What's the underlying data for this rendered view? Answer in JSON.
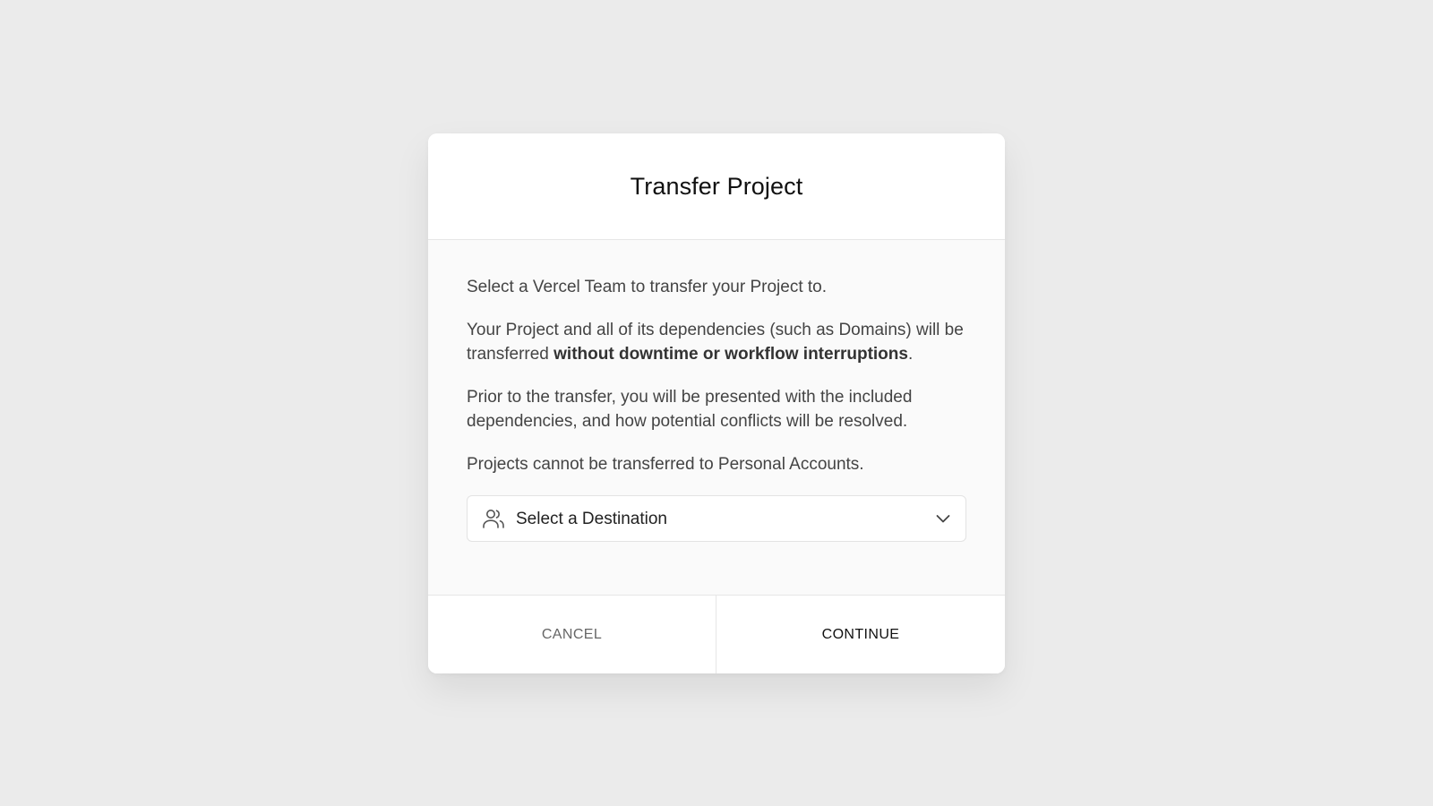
{
  "modal": {
    "title": "Transfer Project",
    "paragraphs": {
      "p1": "Select a Vercel Team to transfer your Project to.",
      "p2_start": "Your Project and all of its dependencies (such as Domains) will be transferred ",
      "p2_bold": "without downtime or workflow interruptions",
      "p2_end": ".",
      "p3": "Prior to the transfer, you will be presented with the included dependencies, and how potential conflicts will be resolved.",
      "p4": "Projects cannot be transferred to Personal Accounts."
    },
    "destination_select": {
      "label": "Select a Destination",
      "icon": "users-icon",
      "chevron": "chevron-down-icon"
    },
    "footer": {
      "cancel_label": "CANCEL",
      "continue_label": "CONTINUE"
    }
  },
  "colors": {
    "page_background": "#ebebeb",
    "modal_background": "#ffffff",
    "body_background": "#fafafa",
    "border": "#e6e6e6",
    "text_primary": "#111111",
    "text_body": "#444444",
    "text_muted": "#666666"
  }
}
